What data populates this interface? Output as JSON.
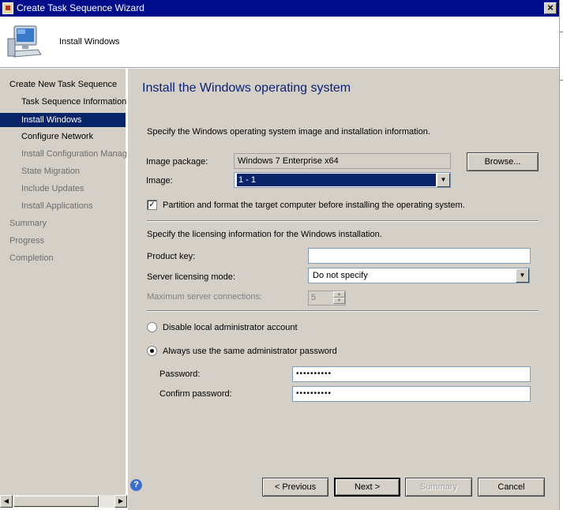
{
  "window": {
    "title": "Create Task Sequence Wizard",
    "close_glyph": "×"
  },
  "header": {
    "step_title": "Install Windows"
  },
  "nav": {
    "items": [
      {
        "label": "Create New Task Sequence",
        "state": "normal"
      },
      {
        "label": "Task Sequence Information",
        "state": "normal"
      },
      {
        "label": "Install Windows",
        "state": "selected"
      },
      {
        "label": "Configure Network",
        "state": "normal"
      },
      {
        "label": "Install Configuration Manag",
        "state": "dim"
      },
      {
        "label": "State Migration",
        "state": "dim"
      },
      {
        "label": "Include Updates",
        "state": "dim"
      },
      {
        "label": "Install Applications",
        "state": "dim"
      },
      {
        "label": "Summary",
        "state": "dim"
      },
      {
        "label": "Progress",
        "state": "dim"
      },
      {
        "label": "Completion",
        "state": "dim"
      }
    ]
  },
  "content": {
    "heading": "Install the Windows operating system",
    "intro": "Specify the Windows operating system image and installation information.",
    "image_package_label": "Image package:",
    "image_package_value": "Windows 7 Enterprise x64",
    "browse_label": "Browse...",
    "image_label": "Image:",
    "image_value": "1 - 1",
    "partition_checked": true,
    "partition_label": "Partition and format the target computer before installing the operating system.",
    "licensing_intro": "Specify the licensing information for the Windows installation.",
    "product_key_label": "Product key:",
    "product_key_value": "",
    "server_licensing_label": "Server licensing mode:",
    "server_licensing_value": "Do not specify",
    "max_connections_label": "Maximum server connections:",
    "max_connections_value": "5",
    "disable_admin_label": "Disable local administrator account",
    "same_password_label": "Always use the same administrator password",
    "selected_radio": "same_password",
    "password_label": "Password:",
    "password_value": "••••••••••",
    "confirm_password_label": "Confirm password:",
    "confirm_password_value": "••••••••••"
  },
  "footer": {
    "help_glyph": "?",
    "previous_label": "< Previous",
    "next_label": "Next >",
    "summary_label": "Summary",
    "cancel_label": "Cancel"
  },
  "glyphs": {
    "dropdown": "▼",
    "left": "◀",
    "right": "▶",
    "up": "▲",
    "down": "▼",
    "check": "✓"
  }
}
